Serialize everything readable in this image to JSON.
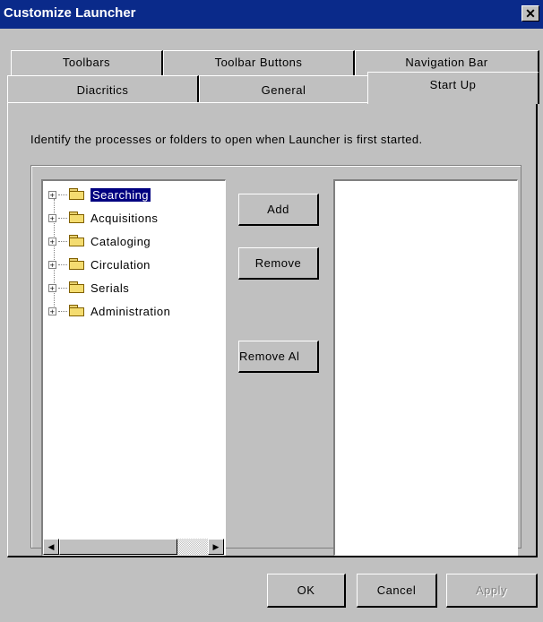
{
  "window": {
    "title": "Customize Launcher",
    "close_glyph": "✕"
  },
  "tabs": {
    "row_back": [
      "Toolbars",
      "Toolbar Buttons",
      "Navigation Bar"
    ],
    "row_front": [
      "Diacritics",
      "General",
      "Start Up"
    ],
    "active": "Start Up"
  },
  "startup": {
    "instruction": "Identify the processes or folders to open when Launcher is first started.",
    "tree_items": [
      "Searching",
      "Acquisitions",
      "Cataloging",
      "Circulation",
      "Serials",
      "Administration"
    ],
    "selected_item": "Searching",
    "buttons": {
      "add": "Add",
      "remove": "Remove",
      "remove_all": "Remove Al"
    },
    "selected_list": []
  },
  "footer": {
    "ok": "OK",
    "cancel": "Cancel",
    "apply": "Apply"
  },
  "colors": {
    "titlebar": "#0a2a8a",
    "face": "#c0c0c0",
    "selection": "#000080"
  },
  "icons": {
    "expander": "plus-box-icon",
    "folder": "folder-icon",
    "scroll_left": "arrow-left-icon",
    "scroll_right": "arrow-right-icon"
  }
}
